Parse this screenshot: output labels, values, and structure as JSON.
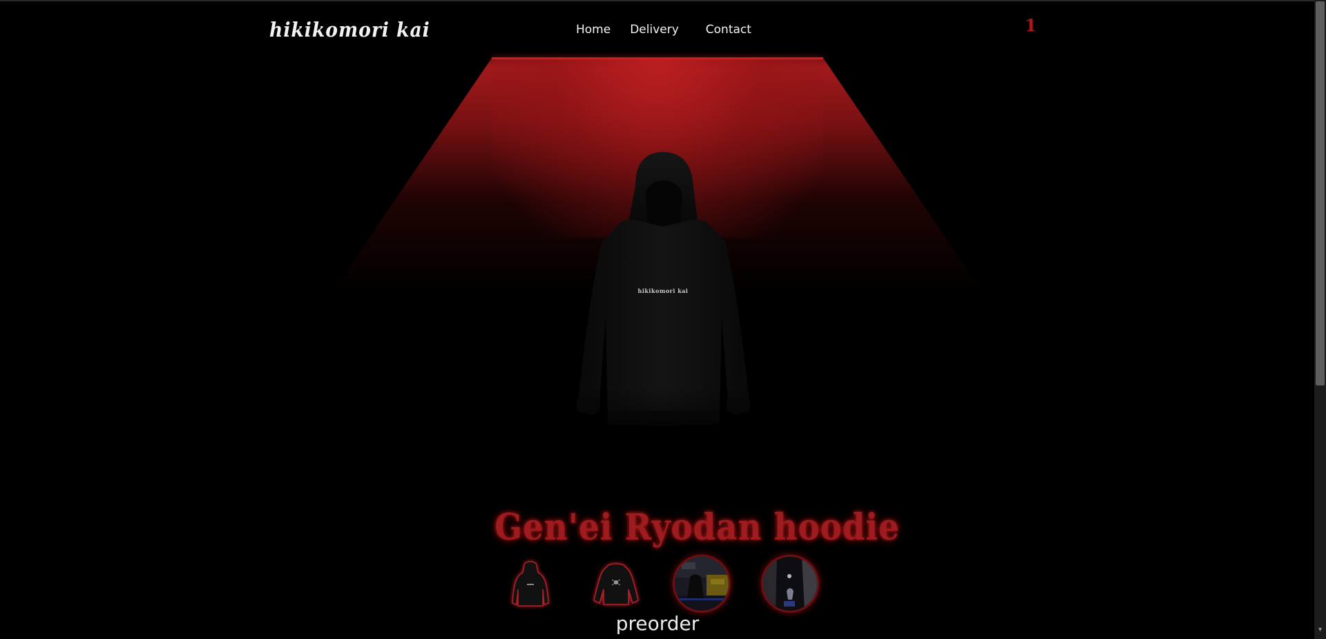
{
  "header": {
    "logo_text": "hikikomori kai",
    "nav": [
      {
        "label": "Home"
      },
      {
        "label": "Delivery"
      },
      {
        "label": "Contact"
      }
    ],
    "cart_count": "1"
  },
  "hero": {
    "product_brand_print": "hikikomori kai",
    "light_color": "#b01c1e"
  },
  "product": {
    "title": "Gen'ei Ryodan hoodie",
    "thumbnails": [
      {
        "name": "hoodie-front"
      },
      {
        "name": "hoodie-back"
      },
      {
        "name": "photo-street"
      },
      {
        "name": "photo-model"
      }
    ],
    "cta_label": "preorder",
    "title_color": "#9e1b1f"
  },
  "scrollbar": {
    "down_arrow_icon": "chevron-down-icon"
  }
}
